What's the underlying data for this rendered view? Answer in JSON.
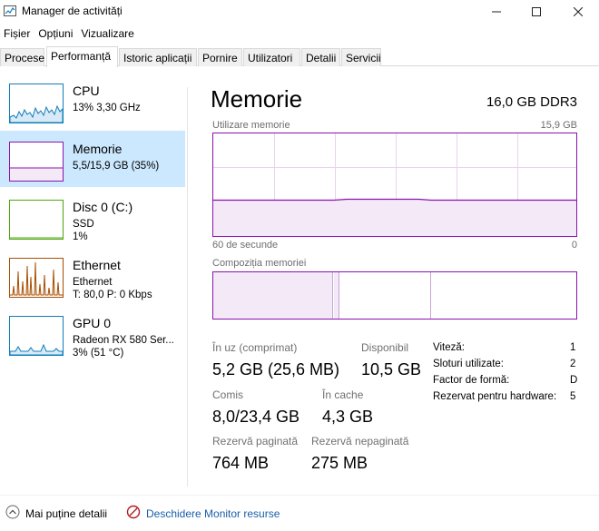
{
  "window": {
    "title": "Manager de activități",
    "icon": "task-manager-icon",
    "buttons": [
      "minimize-icon",
      "maximize-icon",
      "close-icon"
    ]
  },
  "menu": [
    "Fișier",
    "Opțiuni",
    "Vizualizare"
  ],
  "tabs": [
    "Procese",
    "Performanță",
    "Istoric aplicații",
    "Pornire",
    "Utilizatori",
    "Detalii",
    "Servicii"
  ],
  "active_tab": "Performanță",
  "sidebar": {
    "items": [
      {
        "title": "CPU",
        "lines": [
          "13%  3,30 GHz"
        ],
        "color": "#117dbb"
      },
      {
        "title": "Memorie",
        "lines": [
          "5,5/15,9 GB (35%)"
        ],
        "color": "#8b12ae",
        "selected": true
      },
      {
        "title": "Disc 0 (C:)",
        "lines": [
          "SSD",
          "1%"
        ],
        "color": "#4da60c"
      },
      {
        "title": "Ethernet",
        "lines": [
          "Ethernet",
          "T: 80,0  P: 0 Kbps"
        ],
        "color": "#a74f01"
      },
      {
        "title": "GPU 0",
        "lines": [
          "Radeon RX 580 Ser...",
          "3% (51 °C)"
        ],
        "color": "#117dbb"
      }
    ]
  },
  "main": {
    "title": "Memorie",
    "spec": "16,0 GB DDR3",
    "graph_label": "Utilizare memorie",
    "graph_max": "15,9 GB",
    "graph_time": "60 de secunde",
    "graph_zero": "0",
    "composition_label": "Compoziția memoriei",
    "usage_fraction": 0.35,
    "stats": {
      "in_use_label": "În uz (comprimat)",
      "in_use_value": "5,2 GB (25,6 MB)",
      "available_label": "Disponibil",
      "available_value": "10,5 GB",
      "committed_label": "Comis",
      "committed_value": "8,0/23,4 GB",
      "cached_label": "În cache",
      "cached_value": "4,3 GB",
      "paged_label": "Rezervă paginată",
      "paged_value": "764 MB",
      "nonpaged_label": "Rezervă nepaginată",
      "nonpaged_value": "275 MB"
    },
    "details": [
      {
        "label": "Viteză:",
        "value": "1"
      },
      {
        "label": "Sloturi utilizate:",
        "value": "2"
      },
      {
        "label": "Factor de formă:",
        "value": "D"
      },
      {
        "label": "Rezervat pentru hardware:",
        "value": "5"
      }
    ]
  },
  "footer": {
    "fewer_details": "Mai puține detalii",
    "resource_monitor": "Deschidere Monitor resurse"
  },
  "colors": {
    "memory": "#8b12ae",
    "cpu": "#117dbb",
    "disk": "#4da60c",
    "ethernet": "#a74f01",
    "selected_bg": "#cce8ff"
  }
}
